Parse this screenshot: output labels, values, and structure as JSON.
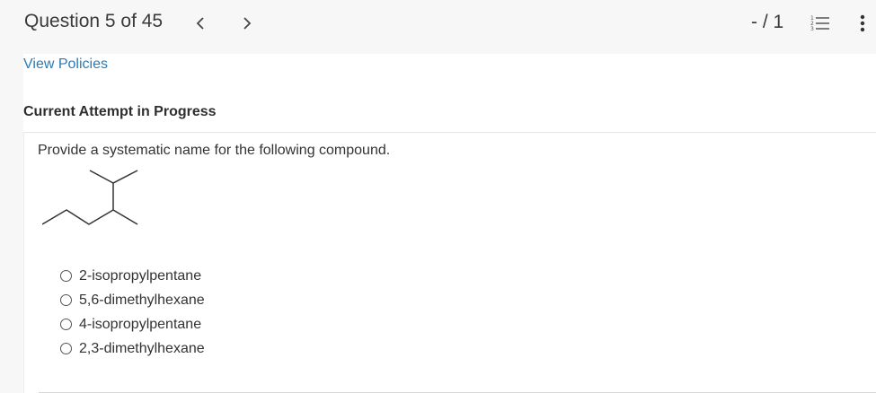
{
  "header": {
    "question_title": "Question 5 of 45",
    "prev_icon": "chevron-left-icon",
    "next_icon": "chevron-right-icon",
    "score": "- / 1",
    "list_icon": "numbered-list-icon",
    "more_icon": "vertical-ellipsis-icon"
  },
  "links": {
    "view_policies": "View Policies"
  },
  "attempt": {
    "heading": "Current Attempt in Progress"
  },
  "question": {
    "prompt": "Provide a systematic name for the following compound.",
    "options": [
      {
        "label": "2-isopropylpentane",
        "selected": false
      },
      {
        "label": "5,6-dimethylhexane",
        "selected": false
      },
      {
        "label": "4-isopropylpentane",
        "selected": false
      },
      {
        "label": "2,3-dimethylhexane",
        "selected": false
      }
    ]
  },
  "colors": {
    "link": "#2a7bb8",
    "header_bg": "#f7f7f7",
    "content_bg": "#ffffff"
  }
}
